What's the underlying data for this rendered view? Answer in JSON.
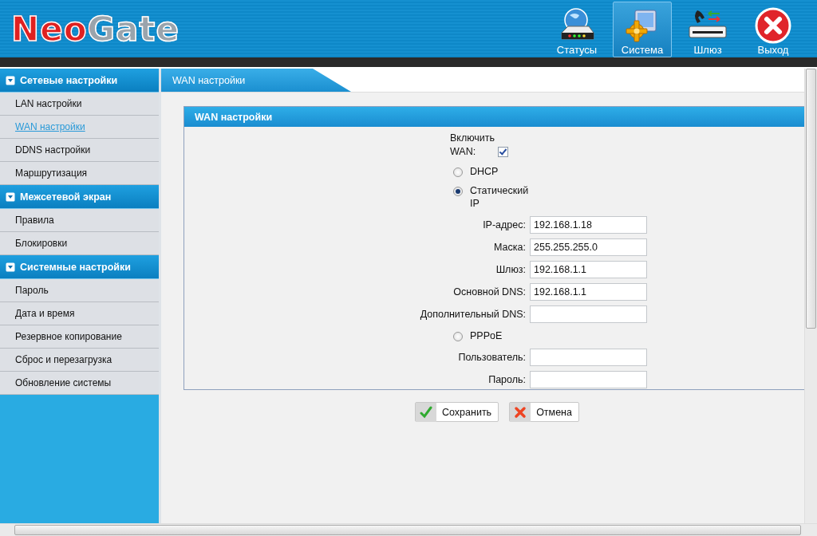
{
  "header": {
    "logo": "NeoGate",
    "nav": [
      {
        "label": "Статусы",
        "kind": "status",
        "selected": false
      },
      {
        "label": "Система",
        "kind": "system",
        "selected": true
      },
      {
        "label": "Шлюз",
        "kind": "gateway",
        "selected": false
      },
      {
        "label": "Выход",
        "kind": "exit",
        "selected": false
      }
    ]
  },
  "sidebar": {
    "sections": [
      {
        "title": "Сетевые настройки",
        "items": [
          {
            "label": "LAN настройки",
            "selected": false
          },
          {
            "label": "WAN настройки",
            "selected": true
          },
          {
            "label": "DDNS настройки",
            "selected": false
          },
          {
            "label": "Маршрутизация",
            "selected": false
          }
        ]
      },
      {
        "title": "Межсетевой экран",
        "items": [
          {
            "label": "Правила",
            "selected": false
          },
          {
            "label": "Блокировки",
            "selected": false
          }
        ]
      },
      {
        "title": "Системные настройки",
        "items": [
          {
            "label": "Пароль",
            "selected": false
          },
          {
            "label": "Дата и время",
            "selected": false
          },
          {
            "label": "Резервное копирование",
            "selected": false
          },
          {
            "label": "Сброс и перезагрузка",
            "selected": false
          },
          {
            "label": "Обновление системы",
            "selected": false
          }
        ]
      }
    ]
  },
  "page_tab": "WAN настройки",
  "panel": {
    "title": "WAN настройки",
    "enable": {
      "label": "Включить WAN:",
      "checked": true
    },
    "modes": [
      {
        "label": "DHCP",
        "selected": false
      },
      {
        "label": "Статический IP",
        "selected": true,
        "fields": [
          {
            "label": "IP-адрес:",
            "value": "192.168.1.18"
          },
          {
            "label": "Маска:",
            "value": "255.255.255.0"
          },
          {
            "label": "Шлюз:",
            "value": "192.168.1.1"
          },
          {
            "label": "Основной DNS:",
            "value": "192.168.1.1"
          },
          {
            "label": "Дополнительный DNS:"
          }
        ]
      },
      {
        "label": "PPPoE",
        "selected": false,
        "fields": [
          {
            "label": "Пользователь:"
          },
          {
            "label": "Пароль:"
          }
        ]
      }
    ]
  },
  "buttons": [
    {
      "label": "Сохранить",
      "kind": "save"
    },
    {
      "label": "Отмена",
      "kind": "cancel"
    }
  ]
}
